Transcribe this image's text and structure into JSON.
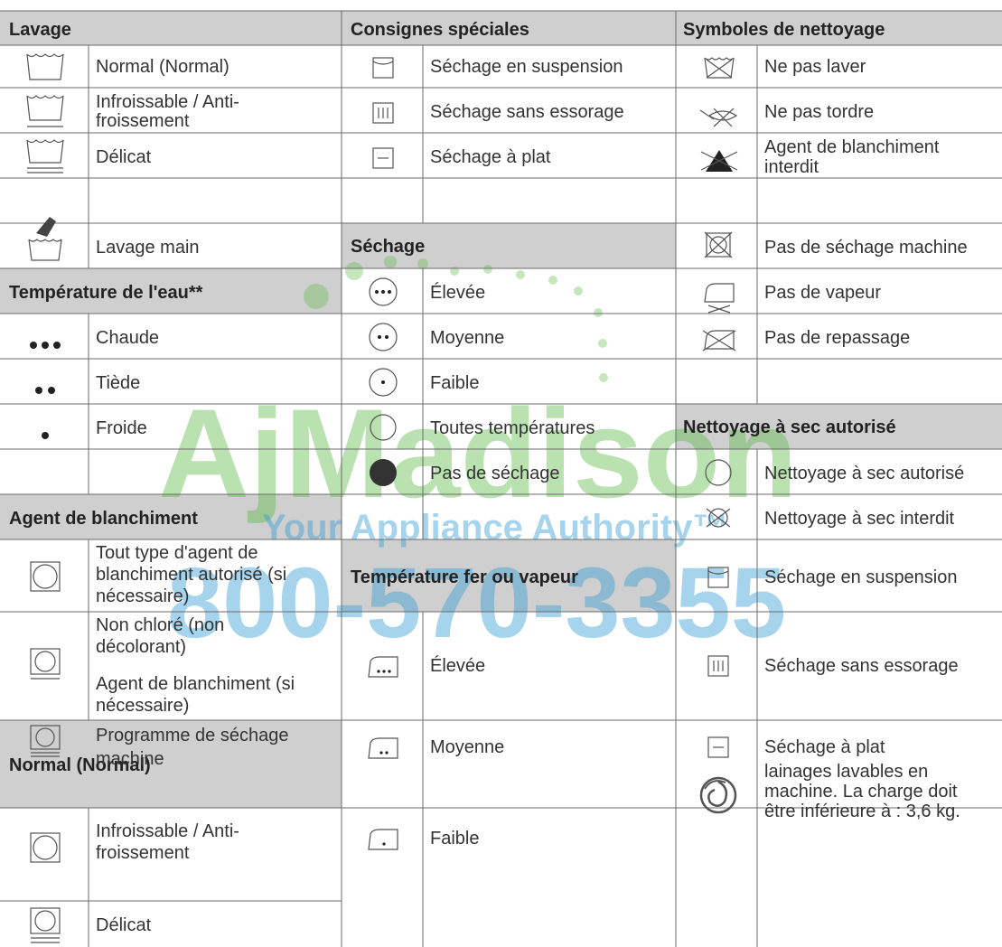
{
  "columns": [
    {
      "header": "Lavage",
      "rows": [
        {
          "icon": "washtub-normal-icon",
          "text": [
            "Normal (Normal)"
          ]
        },
        {
          "icon": "washtub-permanent-press-icon",
          "text": [
            "Infroissable / Anti-",
            "froissement"
          ]
        },
        {
          "icon": "washtub-delicate-icon",
          "text": [
            "Délicat"
          ]
        },
        {
          "icon": "hand-wash-icon",
          "text": [
            "Lavage main"
          ]
        }
      ],
      "section2": {
        "header": "Température de l'eau**",
        "rows": [
          {
            "icon": "three-dots-icon",
            "text": [
              "Chaude"
            ]
          },
          {
            "icon": "two-dots-icon",
            "text": [
              "Tiède"
            ]
          },
          {
            "icon": "one-dot-icon",
            "text": [
              "Froide"
            ]
          }
        ]
      },
      "section3": {
        "header": "Agent de blanchiment",
        "rows": [
          {
            "icon": "bleach-any-icon",
            "text": [
              "Tout type d'agent de",
              "blanchiment autorisé (si",
              "nécessaire)"
            ]
          },
          {
            "icon": "bleach-non-chlorine-icon",
            "text": [
              "Non chloré (non",
              "décolorant)",
              "Agent de blanchiment (si",
              "nécessaire)"
            ]
          },
          {
            "icon": "tumble-dry-icon",
            "text": [
              "Programme de séchage",
              "machine"
            ]
          }
        ]
      },
      "section4": {
        "header": "Normal (Normal)",
        "rows": [
          {
            "icon": "tumble-dry-permanent-press-icon",
            "text": [
              "Infroissable / Anti-",
              "froissement"
            ]
          },
          {
            "icon": "tumble-dry-delicate-icon",
            "text": [
              "Délicat"
            ]
          }
        ]
      }
    },
    {
      "header": "Consignes spéciales",
      "rows": [
        {
          "icon": "line-dry-icon",
          "text": [
            "Séchage en suspension"
          ]
        },
        {
          "icon": "drip-dry-icon",
          "text": [
            "Séchage sans essorage"
          ]
        },
        {
          "icon": "dry-flat-icon",
          "text": [
            "Séchage à plat"
          ]
        }
      ],
      "section2": {
        "header": "Séchage",
        "rows": [
          {
            "icon": "dry-high-heat-icon",
            "text": [
              "Élevée"
            ]
          },
          {
            "icon": "dry-medium-heat-icon",
            "text": [
              "Moyenne"
            ]
          },
          {
            "icon": "dry-low-heat-icon",
            "text": [
              "Faible"
            ]
          },
          {
            "icon": "dry-any-heat-icon",
            "text": [
              "Toutes températures"
            ]
          },
          {
            "icon": "dry-no-heat-icon",
            "text": [
              "Pas de séchage"
            ]
          }
        ]
      },
      "section3": {
        "header": "Température fer ou vapeur",
        "rows": [
          {
            "icon": "iron-high-icon",
            "text": [
              "Élevée"
            ]
          },
          {
            "icon": "iron-medium-icon",
            "text": [
              "Moyenne"
            ]
          },
          {
            "icon": "iron-low-icon",
            "text": [
              "Faible"
            ]
          }
        ]
      }
    },
    {
      "header": "Symboles de nettoyage",
      "rows": [
        {
          "icon": "do-not-wash-icon",
          "text": [
            "Ne pas laver"
          ]
        },
        {
          "icon": "do-not-wring-icon",
          "text": [
            "Ne pas tordre"
          ]
        },
        {
          "icon": "do-not-bleach-icon",
          "text": [
            "Agent de blanchiment",
            "interdit"
          ]
        },
        {
          "icon": "do-not-tumble-dry-icon",
          "text": [
            "Pas de séchage machine"
          ]
        },
        {
          "icon": "no-steam-icon",
          "text": [
            "Pas de vapeur"
          ]
        },
        {
          "icon": "do-not-iron-icon",
          "text": [
            "Pas de repassage"
          ]
        }
      ],
      "section2": {
        "header": "Nettoyage à sec autorisé",
        "rows": [
          {
            "icon": "dry-clean-icon",
            "text": [
              "Nettoyage à sec autorisé"
            ]
          },
          {
            "icon": "do-not-dry-clean-icon",
            "text": [
              "Nettoyage à sec interdit"
            ]
          },
          {
            "icon": "line-dry-icon",
            "text": [
              "Séchage en suspension"
            ]
          },
          {
            "icon": "drip-dry-icon",
            "text": [
              "Séchage sans essorage"
            ]
          },
          {
            "icon": "dry-flat-icon",
            "text": [
              "Séchage à plat"
            ]
          },
          {
            "icon": "wool-machine-wash-icon",
            "text": [
              "lainages lavables en",
              "machine. La charge doit",
              "être inférieure à : 3,6 kg."
            ]
          }
        ]
      }
    }
  ],
  "watermark": {
    "brand": "AjMadison",
    "tagline": "Your Appliance Authority™",
    "phone": "800-570-3355"
  }
}
